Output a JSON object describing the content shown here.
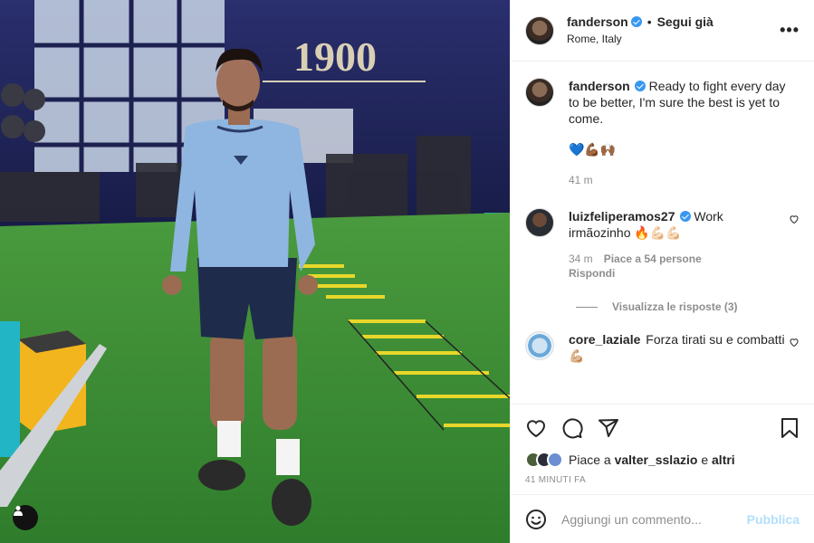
{
  "post": {
    "username": "fanderson",
    "follow_state": "Segui già",
    "location": "Rome, Italy",
    "more_label": "•••",
    "caption": "Ready to fight every day to be better, I'm sure the best is yet to come.",
    "caption_emojis": "💙💪🏾🙌🏾",
    "caption_time": "41 m",
    "gym_sign": "1900"
  },
  "comments": [
    {
      "username": "luizfeliperamos27",
      "text": "Work irmãozinho 🔥💪🏻💪🏻",
      "time": "34 m",
      "likes": "Piace a 54 persone",
      "reply_label": "Rispondi",
      "view_replies": "Visualizza le risposte (3)"
    },
    {
      "username": "core_laziale",
      "text": "Forza tirati su e combatti 💪🏼"
    }
  ],
  "likes": {
    "prefix": "Piace a ",
    "user": "valter_sslazio",
    "connector": " e ",
    "suffix": "altri"
  },
  "timestamp": "41 MINUTI FA",
  "add_comment": {
    "placeholder": "Aggiungi un commento...",
    "publish": "Pubblica"
  },
  "icons": [
    "heart-icon",
    "comment-icon",
    "share-icon",
    "bookmark-icon",
    "emoji-icon",
    "user-tag-icon"
  ],
  "colors": {
    "verified": "#3897f0",
    "publish_disabled": "#b2dffc",
    "secondary_text": "#8e8e8e",
    "turf": "#3f8f3a",
    "wall": "#1a1f52"
  }
}
